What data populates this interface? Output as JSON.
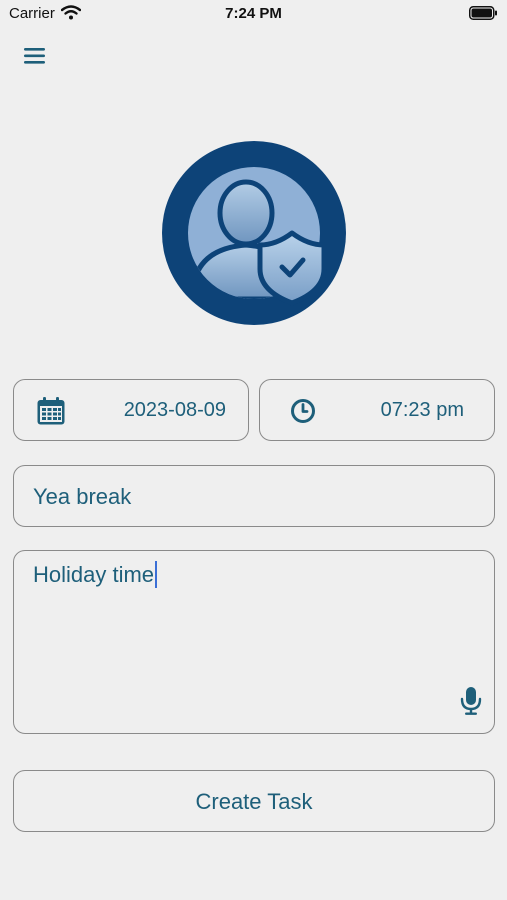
{
  "status_bar": {
    "carrier": "Carrier",
    "time": "7:24 PM"
  },
  "icons": {
    "menu": "hamburger-menu-icon",
    "avatar": "user-shield-icon",
    "date": "calendar-icon",
    "time": "clock-icon",
    "voice": "microphone-icon"
  },
  "form": {
    "date": "2023-08-09",
    "time": "07:23 pm",
    "title": "Yea break",
    "description": "Holiday time"
  },
  "actions": {
    "create_label": "Create Task"
  },
  "colors": {
    "accent": "#1e5f7a",
    "avatar_bg": "#0d4378",
    "background": "#efefef"
  }
}
